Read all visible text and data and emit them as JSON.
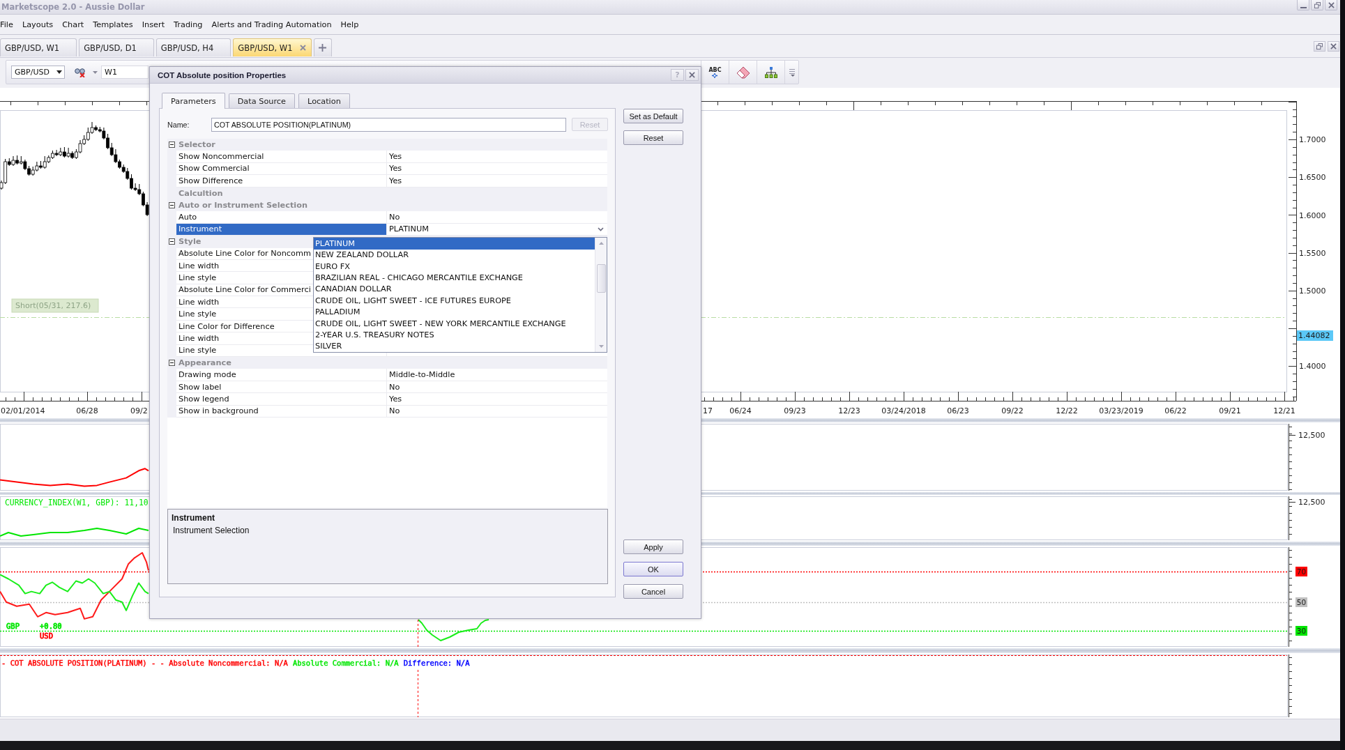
{
  "window": {
    "title": "Marketscope 2.0 - Aussie Dollar"
  },
  "menu": [
    "File",
    "Layouts",
    "Chart",
    "Templates",
    "Insert",
    "Trading",
    "Alerts and Trading Automation",
    "Help"
  ],
  "tabs": [
    {
      "label": "GBP/USD, W1",
      "selected": false
    },
    {
      "label": "GBP/USD, D1",
      "selected": false
    },
    {
      "label": "GBP/USD, H4",
      "selected": false
    },
    {
      "label": "GBP/USD, W1",
      "selected": true
    }
  ],
  "toolbar": {
    "symbol": "GBP/USD",
    "timeframe": "W1",
    "tools": [
      {
        "kind": "text",
        "label": "ABC"
      },
      {
        "kind": "eraser"
      },
      {
        "kind": "hierarchy"
      },
      {
        "kind": "overflow"
      }
    ]
  },
  "price_chart": {
    "order_label": "Short(05/31, 217.6)",
    "price_labels": [
      "1.7000",
      "1.6500",
      "1.6000",
      "1.5500",
      "1.5000",
      "1.4000"
    ],
    "current_price": "1.44082",
    "date_labels": [
      "02/01/2014",
      "06/28",
      "09/2",
      "17",
      "06/24",
      "09/23",
      "12/23",
      "03/24/2018",
      "06/23",
      "09/22",
      "12/22",
      "03/23/2019",
      "06/22",
      "09/21",
      "12/21"
    ]
  },
  "indicators": [
    {
      "kind": "line",
      "color": "#ff0000",
      "axis_labels": [
        "12,500"
      ]
    },
    {
      "kind": "line",
      "color": "#00e600",
      "legend": "CURRENCY_INDEX(W1, GBP): 11,10",
      "axis_labels": [
        "12,500"
      ]
    },
    {
      "kind": "oscillator",
      "levels": [
        {
          "label": "70",
          "color": "#ff0000"
        },
        {
          "label": "50",
          "color": "#c0c0c0"
        },
        {
          "label": "30",
          "color": "#00e600"
        }
      ],
      "tags": [
        {
          "label": "GBP",
          "color": "#00e600"
        },
        {
          "label": "+0.80",
          "color": "#00e600"
        },
        {
          "label": "USD",
          "color": "#ff0000"
        }
      ]
    },
    {
      "kind": "cot",
      "legend": [
        {
          "text": "- COT ABSOLUTE POSITION(PLATINUM) - - Absolute Noncommercial: N/A",
          "color": "#ff0000"
        },
        {
          "text": "Absolute Commercial: N/A",
          "color": "#00e600"
        },
        {
          "text": "Difference: N/A",
          "color": "#0000ff"
        }
      ]
    }
  ],
  "dialog": {
    "title": "COT Absolute position Properties",
    "help": "?",
    "tabs": [
      {
        "label": "Parameters",
        "selected": true
      },
      {
        "label": "Data Source",
        "selected": false
      },
      {
        "label": "Location",
        "selected": false
      }
    ],
    "name_field": {
      "label": "Name:",
      "value": "COT ABSOLUTE POSITION(PLATINUM)",
      "reset": {
        "label": "Reset",
        "disabled": true
      }
    },
    "side_buttons": [
      {
        "label": "Set as Default"
      },
      {
        "label": "Reset"
      }
    ],
    "properties": [
      {
        "label": "Selector",
        "expanded": true,
        "children": [
          {
            "name": "Show Noncommercial",
            "value": "Yes",
            "selected": false
          },
          {
            "name": "Show Commercial",
            "value": "Yes",
            "selected": false
          },
          {
            "name": "Show Difference",
            "value": "Yes",
            "selected": false
          }
        ]
      },
      {
        "label": "Calcultion"
      },
      {
        "label": "Auto or Instrument Selection",
        "expanded": true,
        "children": [
          {
            "name": "Auto",
            "value": "No",
            "selected": false
          },
          {
            "name": "Instrument",
            "value": "PLATINUM",
            "selected": true,
            "options": [
              {
                "label": "PLATINUM",
                "selected": true
              },
              {
                "label": "NEW ZEALAND DOLLAR",
                "selected": false
              },
              {
                "label": "EURO FX",
                "selected": false
              },
              {
                "label": "BRAZILIAN REAL - CHICAGO MERCANTILE EXCHANGE",
                "selected": false
              },
              {
                "label": "CANADIAN DOLLAR",
                "selected": false
              },
              {
                "label": "CRUDE OIL, LIGHT SWEET - ICE FUTURES EUROPE",
                "selected": false
              },
              {
                "label": "PALLADIUM",
                "selected": false
              },
              {
                "label": "CRUDE OIL, LIGHT SWEET - NEW YORK MERCANTILE EXCHANGE",
                "selected": false
              },
              {
                "label": "2-YEAR U.S. TREASURY NOTES",
                "selected": false
              },
              {
                "label": "SILVER",
                "selected": false
              }
            ]
          }
        ]
      },
      {
        "label": "Style",
        "expanded": true,
        "children": [
          {
            "name": "Absolute Line Color for Noncomm",
            "selected": false
          },
          {
            "name": "Line width",
            "selected": false
          },
          {
            "name": "Line style",
            "selected": false
          },
          {
            "name": "Absolute Line Color for Commerci",
            "selected": false
          },
          {
            "name": "Line width",
            "selected": false
          },
          {
            "name": "Line style",
            "selected": false
          },
          {
            "name": "Line Color for Difference",
            "selected": false
          },
          {
            "name": "Line width",
            "selected": false
          },
          {
            "name": "Line style",
            "selected": false
          }
        ]
      },
      {
        "label": "Appearance",
        "expanded": true,
        "children": [
          {
            "name": "Drawing mode",
            "value": "Middle-to-Middle",
            "selected": false
          },
          {
            "name": "Show label",
            "value": "No",
            "selected": false
          },
          {
            "name": "Show legend",
            "value": "Yes",
            "selected": false
          },
          {
            "name": "Show in background",
            "value": "No",
            "selected": false
          }
        ]
      }
    ],
    "description": {
      "title": "Instrument",
      "text": "Instrument Selection"
    },
    "buttons": [
      {
        "label": "Apply",
        "default": false
      },
      {
        "label": "OK",
        "default": true
      },
      {
        "label": "Cancel",
        "default": false
      }
    ]
  }
}
